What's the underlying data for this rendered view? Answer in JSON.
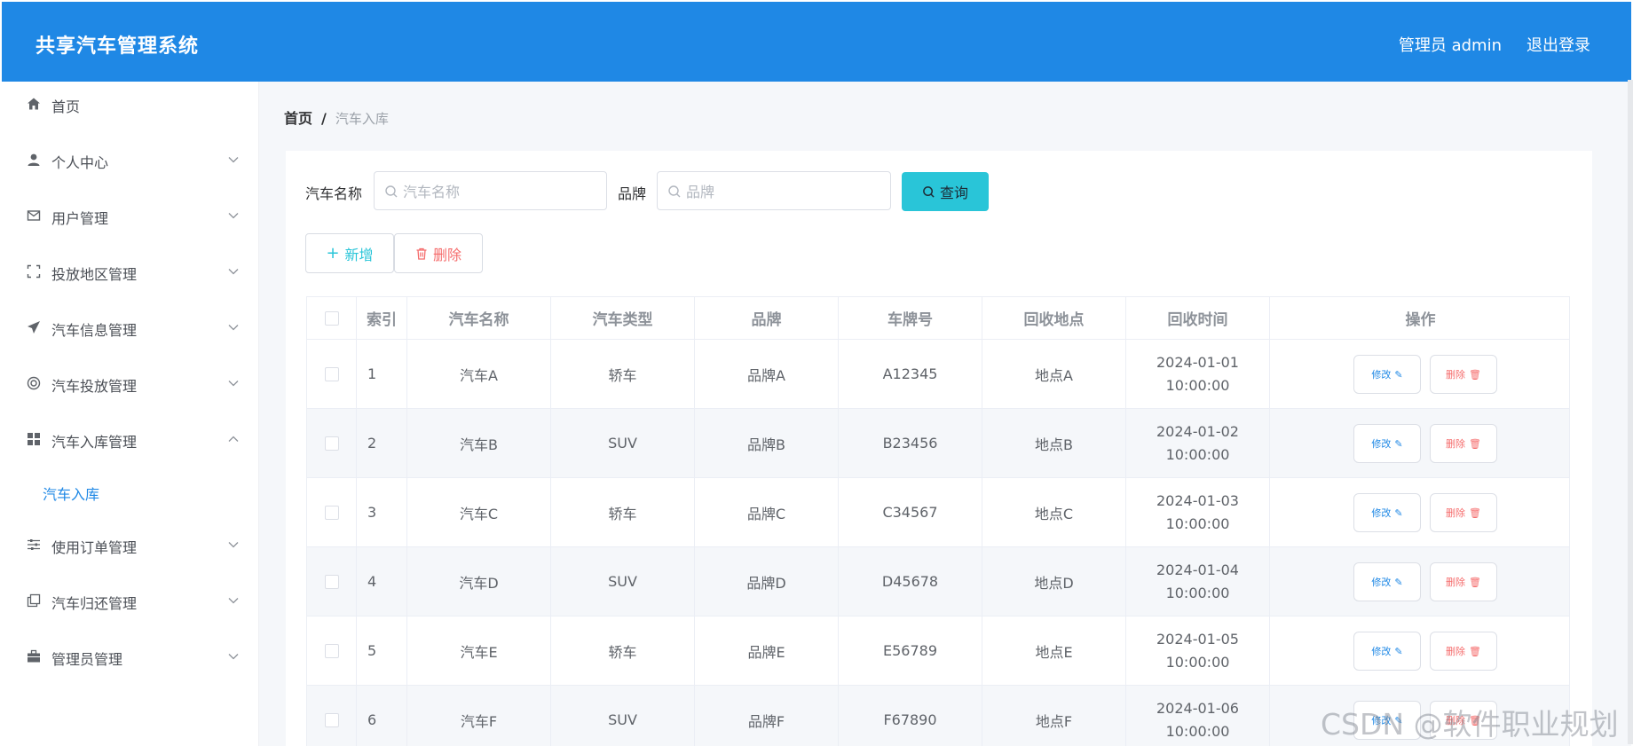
{
  "header": {
    "title": "共享汽车管理系统",
    "user": "管理员 admin",
    "logout": "退出登录"
  },
  "sidebar": {
    "items": [
      {
        "label": "首页",
        "icon": "home-icon"
      },
      {
        "label": "个人中心",
        "icon": "user-icon",
        "expanded": false
      },
      {
        "label": "用户管理",
        "icon": "mail-icon",
        "expanded": false
      },
      {
        "label": "投放地区管理",
        "icon": "fullscreen-icon",
        "expanded": false
      },
      {
        "label": "汽车信息管理",
        "icon": "send-icon",
        "expanded": false
      },
      {
        "label": "汽车投放管理",
        "icon": "lifebuoy-icon",
        "expanded": false
      },
      {
        "label": "汽车入库管理",
        "icon": "grid-icon",
        "expanded": true
      },
      {
        "label": "使用订单管理",
        "icon": "sliders-icon",
        "expanded": false
      },
      {
        "label": "汽车归还管理",
        "icon": "copy-icon",
        "expanded": false
      },
      {
        "label": "管理员管理",
        "icon": "briefcase-icon",
        "expanded": false
      }
    ],
    "submenu": {
      "label": "汽车入库"
    }
  },
  "breadcrumb": {
    "home": "首页",
    "separator": "/",
    "current": "汽车入库"
  },
  "filters": {
    "name_label": "汽车名称",
    "name_placeholder": "汽车名称",
    "name_value": "",
    "brand_label": "品牌",
    "brand_placeholder": "品牌",
    "brand_value": "",
    "search_label": "查询"
  },
  "actions": {
    "add_label": "新增",
    "delete_label": "删除"
  },
  "table": {
    "columns": [
      "索引",
      "汽车名称",
      "汽车类型",
      "品牌",
      "车牌号",
      "回收地点",
      "回收时间",
      "操作"
    ],
    "edit_label": "修改",
    "delete_label": "删除",
    "rows": [
      {
        "index": "1",
        "name": "汽车A",
        "type": "轿车",
        "brand": "品牌A",
        "plate": "A12345",
        "location": "地点A",
        "time": "2024-01-01 10:00:00"
      },
      {
        "index": "2",
        "name": "汽车B",
        "type": "SUV",
        "brand": "品牌B",
        "plate": "B23456",
        "location": "地点B",
        "time": "2024-01-02 10:00:00"
      },
      {
        "index": "3",
        "name": "汽车C",
        "type": "轿车",
        "brand": "品牌C",
        "plate": "C34567",
        "location": "地点C",
        "time": "2024-01-03 10:00:00"
      },
      {
        "index": "4",
        "name": "汽车D",
        "type": "SUV",
        "brand": "品牌D",
        "plate": "D45678",
        "location": "地点D",
        "time": "2024-01-04 10:00:00"
      },
      {
        "index": "5",
        "name": "汽车E",
        "type": "轿车",
        "brand": "品牌E",
        "plate": "E56789",
        "location": "地点E",
        "time": "2024-01-05 10:00:00"
      },
      {
        "index": "6",
        "name": "汽车F",
        "type": "SUV",
        "brand": "品牌F",
        "plate": "F67890",
        "location": "地点F",
        "time": "2024-01-06 10:00:00"
      }
    ]
  },
  "watermark": "CSDN @软件职业规划",
  "colors": {
    "header": "#1f88e5",
    "accent": "#1f88e5",
    "search_button": "#29c5d8",
    "add": "#29c5d8",
    "danger": "#f56c6c"
  }
}
